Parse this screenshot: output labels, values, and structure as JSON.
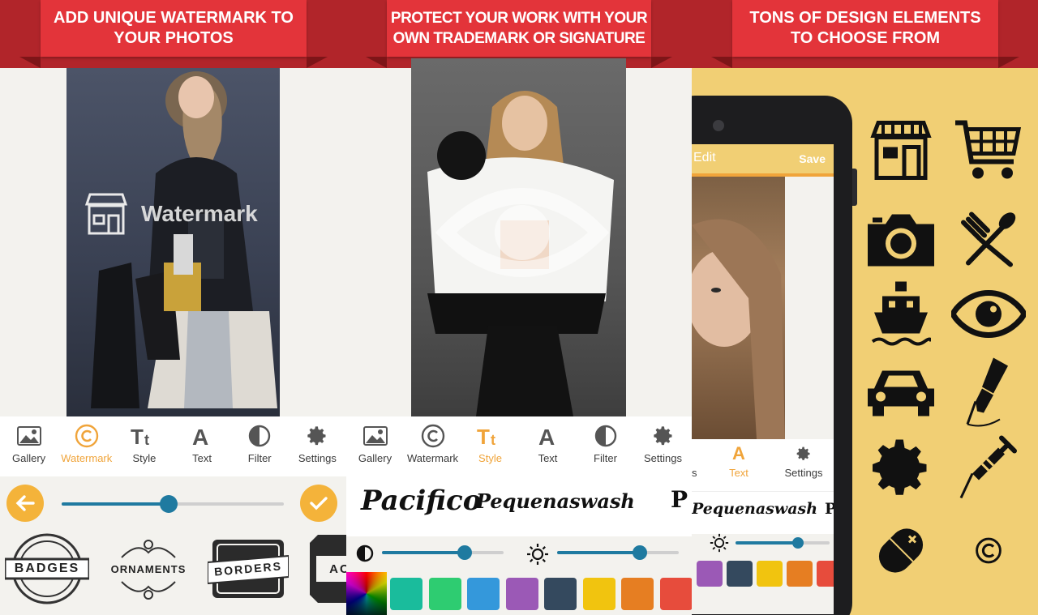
{
  "panel1": {
    "headline_line1": "ADD UNIQUE WATERMARK TO",
    "headline_line2": "YOUR PHOTOS",
    "watermark_text": "Watermark",
    "toolbar": [
      {
        "label": "Gallery",
        "icon": "image-icon",
        "active": false
      },
      {
        "label": "Watermark",
        "icon": "copyright-icon",
        "active": true
      },
      {
        "label": "Style",
        "icon": "text-style-icon",
        "active": false
      },
      {
        "label": "Text",
        "icon": "letter-a-icon",
        "active": false
      },
      {
        "label": "Filter",
        "icon": "contrast-icon",
        "active": false
      },
      {
        "label": "Settings",
        "icon": "gear-icon",
        "active": false
      }
    ],
    "slider_value": 0.48,
    "categories": [
      "BADGES",
      "ORNAMENTS",
      "BORDERS",
      "AC"
    ]
  },
  "panel2": {
    "headline_line1": "PROTECT YOUR WORK WITH YOUR",
    "headline_line2": "OWN TRADEMARK OR SIGNATURE",
    "toolbar": [
      {
        "label": "Gallery",
        "icon": "image-icon",
        "active": false
      },
      {
        "label": "Watermark",
        "icon": "copyright-icon",
        "active": false
      },
      {
        "label": "Style",
        "icon": "text-style-icon",
        "active": true
      },
      {
        "label": "Text",
        "icon": "letter-a-icon",
        "active": false
      },
      {
        "label": "Filter",
        "icon": "contrast-icon",
        "active": false
      },
      {
        "label": "Settings",
        "icon": "gear-icon",
        "active": false
      }
    ],
    "fonts": [
      "Pacifico",
      "Pequenaswash",
      "P"
    ],
    "contrast_value": 0.68,
    "brightness_value": 0.68,
    "swatches": [
      "#1abc9c",
      "#2ecc71",
      "#3498db",
      "#9b59b6",
      "#34495e",
      "#f1c40f",
      "#e67e22",
      "#e74c3c"
    ]
  },
  "panel3": {
    "headline_line1": "TONS OF DESIGN ELEMENTS",
    "headline_line2": "TO CHOOSE FROM",
    "phone": {
      "header_left": "Edit",
      "header_right": "Save",
      "toolbar_partial": "s",
      "toolbar": [
        {
          "label": "Text",
          "icon": "letter-a-icon",
          "active": true
        },
        {
          "label": "Settings",
          "icon": "gear-icon",
          "active": false
        }
      ],
      "fonts": [
        "Pequenaswash",
        "Pr"
      ],
      "brightness_value": 0.66,
      "swatches": [
        "#9b59b6",
        "#34495e",
        "#f1c40f",
        "#e67e22",
        "#e74c3c"
      ]
    },
    "icons": [
      "storefront-icon",
      "shopping-cart-icon",
      "camera-icon",
      "fork-spoon-icon",
      "boat-icon",
      "eye-icon",
      "car-icon",
      "fountain-pen-icon",
      "gear-icon",
      "syringe-icon",
      "pill-icon",
      "copyright-icon"
    ]
  }
}
